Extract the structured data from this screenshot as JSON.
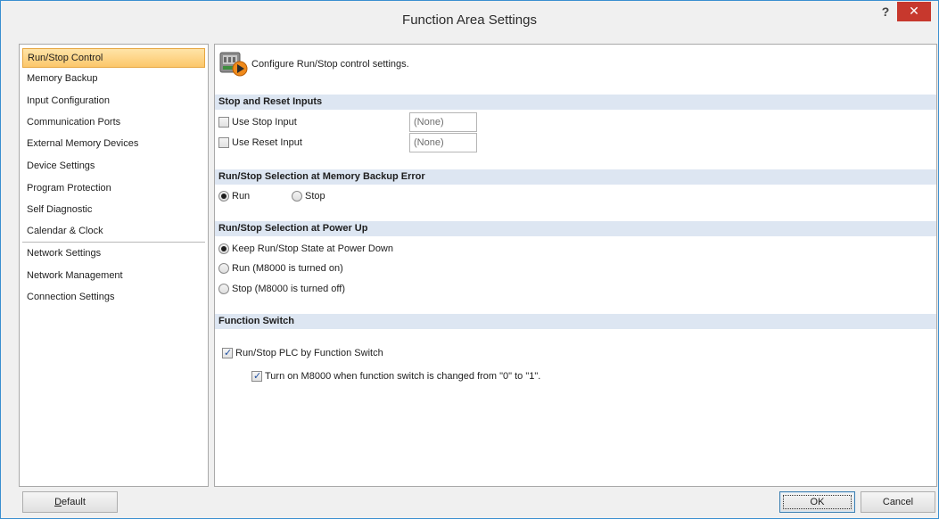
{
  "window": {
    "title": "Function Area Settings",
    "help_label": "?",
    "close_label": "✕"
  },
  "nav": {
    "items": [
      {
        "label": "Run/Stop Control",
        "selected": true
      },
      {
        "label": "Memory Backup"
      },
      {
        "label": "Input Configuration"
      },
      {
        "label": "Communication Ports"
      },
      {
        "label": "External Memory Devices"
      },
      {
        "label": "Device Settings"
      },
      {
        "label": "Program Protection"
      },
      {
        "label": "Self Diagnostic"
      },
      {
        "label": "Calendar & Clock"
      },
      {
        "label": "Network Settings"
      },
      {
        "label": "Network Management"
      },
      {
        "label": "Connection Settings"
      }
    ]
  },
  "content": {
    "header_text": "Configure Run/Stop control settings.",
    "sections": {
      "stop_reset": {
        "title": "Stop and Reset Inputs",
        "use_stop_input": {
          "label": "Use Stop Input",
          "checked": false,
          "value": "(None)"
        },
        "use_reset_input": {
          "label": "Use Reset Input",
          "checked": false,
          "value": "(None)"
        }
      },
      "memory_backup_error": {
        "title": "Run/Stop Selection at Memory Backup Error",
        "options": [
          {
            "label": "Run",
            "selected": true
          },
          {
            "label": "Stop",
            "selected": false
          }
        ]
      },
      "power_up": {
        "title": "Run/Stop Selection at Power Up",
        "options": [
          {
            "label": "Keep Run/Stop State at Power Down",
            "selected": true
          },
          {
            "label": "Run (M8000 is turned on)",
            "selected": false
          },
          {
            "label": "Stop (M8000 is turned off)",
            "selected": false
          }
        ]
      },
      "function_switch": {
        "title": "Function Switch",
        "run_stop_by_switch": {
          "label": "Run/Stop PLC by Function Switch",
          "checked": true
        },
        "turn_on_m8000": {
          "label": "Turn on M8000 when function switch is changed from \"0\" to \"1\".",
          "checked": true
        }
      }
    }
  },
  "footer": {
    "default_label": "Default",
    "ok_label": "OK",
    "cancel_label": "Cancel"
  },
  "colors": {
    "selection_bg": "#fcc76a",
    "section_bar_bg": "#dde6f2",
    "close_button_bg": "#c7382d",
    "window_border": "#3a8fd0"
  }
}
